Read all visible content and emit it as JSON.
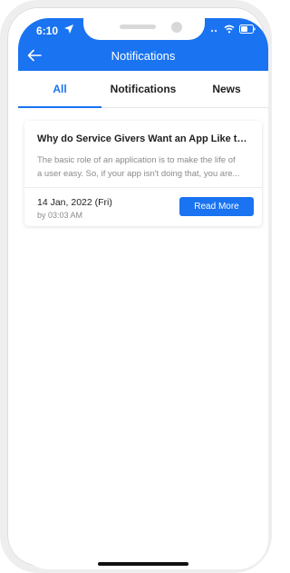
{
  "status_bar": {
    "time": "6:10"
  },
  "header": {
    "title": "Notifications",
    "background": "#1a73f0"
  },
  "tabs": [
    {
      "label": "All",
      "active": true
    },
    {
      "label": "Notifications",
      "active": false
    },
    {
      "label": "News",
      "active": false
    }
  ],
  "items": [
    {
      "title": "Why do Service Givers Want an App Like th...",
      "description_line1": "The basic role of an application is to make the life of",
      "description_line2": "a user easy. So, if your app isn't doing that, you are...",
      "date": "14 Jan, 2022 (Fri)",
      "time": "by 03:03 AM",
      "button_label": "Read More"
    }
  ],
  "accent_color": "#1a73f0"
}
